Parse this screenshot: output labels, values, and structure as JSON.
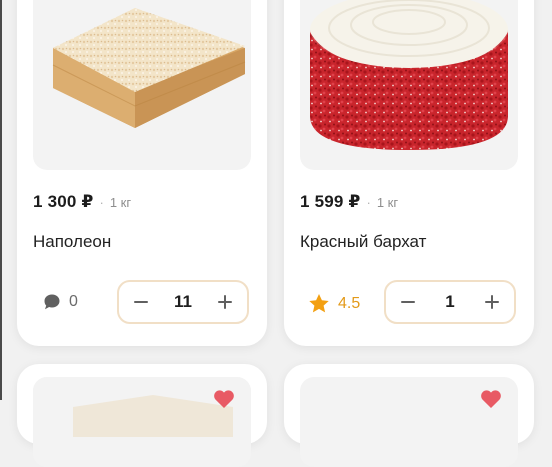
{
  "products": [
    {
      "price": "1 300 ₽",
      "separator": "·",
      "weight": "1 кг",
      "name": "Наполеон",
      "meta_icon": "comment-icon",
      "meta_value": "0",
      "quantity": "11"
    },
    {
      "price": "1 599 ₽",
      "separator": "·",
      "weight": "1 кг",
      "name": "Красный бархат",
      "meta_icon": "star-icon",
      "meta_value": "4.5",
      "quantity": "1"
    }
  ],
  "colors": {
    "rating": "#e39a1a",
    "stepper_border": "#f1dfc6",
    "favorite": "#e85a64"
  }
}
